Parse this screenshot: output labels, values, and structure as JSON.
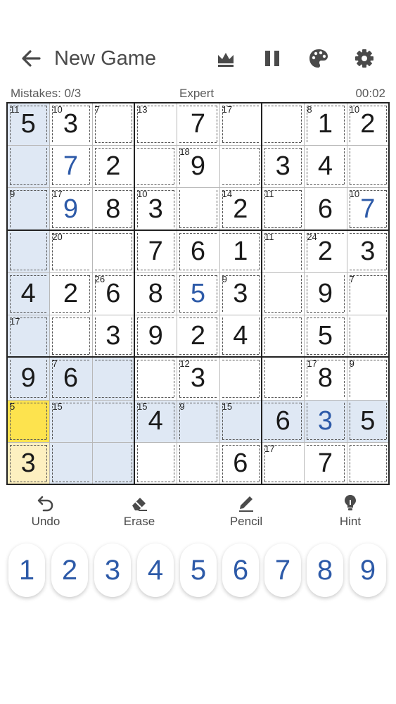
{
  "header": {
    "title": "New Game",
    "icons": [
      "back-arrow-icon",
      "crown-icon",
      "pause-icon",
      "palette-icon",
      "gear-icon"
    ]
  },
  "status": {
    "mistakes": "Mistakes: 0/3",
    "difficulty": "Expert",
    "timer": "00:02"
  },
  "board": {
    "rows": [
      [
        5,
        3,
        0,
        0,
        7,
        0,
        0,
        1,
        2
      ],
      [
        0,
        7,
        2,
        0,
        9,
        0,
        3,
        4,
        0
      ],
      [
        0,
        9,
        8,
        3,
        0,
        2,
        0,
        6,
        7
      ],
      [
        0,
        0,
        0,
        7,
        6,
        1,
        0,
        2,
        3
      ],
      [
        4,
        2,
        6,
        8,
        5,
        3,
        0,
        9,
        0
      ],
      [
        0,
        0,
        3,
        9,
        2,
        4,
        0,
        5,
        0
      ],
      [
        9,
        6,
        0,
        0,
        3,
        0,
        0,
        8,
        0
      ],
      [
        0,
        0,
        0,
        4,
        0,
        0,
        6,
        3,
        5
      ],
      [
        3,
        0,
        0,
        0,
        0,
        6,
        0,
        7,
        0
      ]
    ],
    "user_entered": [
      [
        1,
        1
      ],
      [
        2,
        1
      ],
      [
        2,
        8
      ],
      [
        4,
        4
      ],
      [
        7,
        7
      ]
    ],
    "selected": [
      7,
      0
    ],
    "same_value": [
      [
        8,
        0
      ]
    ],
    "cages": [
      {
        "sum": "11",
        "cells": [
          [
            0,
            0
          ],
          [
            1,
            0
          ]
        ]
      },
      {
        "sum": "10",
        "cells": [
          [
            0,
            1
          ],
          [
            1,
            1
          ]
        ]
      },
      {
        "sum": "7",
        "cells": [
          [
            0,
            2
          ]
        ]
      },
      {
        "sum": "13",
        "cells": [
          [
            0,
            3
          ],
          [
            0,
            4
          ]
        ]
      },
      {
        "sum": "17",
        "cells": [
          [
            0,
            5
          ],
          [
            0,
            6
          ]
        ]
      },
      {
        "sum": "8",
        "cells": [
          [
            0,
            7
          ],
          [
            1,
            7
          ]
        ]
      },
      {
        "sum": "10",
        "cells": [
          [
            0,
            8
          ],
          [
            1,
            8
          ]
        ]
      },
      {
        "sum": "18",
        "cells": [
          [
            1,
            4
          ],
          [
            1,
            5
          ],
          [
            2,
            4
          ]
        ]
      },
      {
        "sum": "",
        "cells": [
          [
            1,
            2
          ],
          [
            1,
            3
          ]
        ]
      },
      {
        "sum": "",
        "cells": [
          [
            1,
            6
          ]
        ]
      },
      {
        "sum": "9",
        "cells": [
          [
            2,
            0
          ],
          [
            3,
            0
          ]
        ]
      },
      {
        "sum": "17",
        "cells": [
          [
            2,
            1
          ],
          [
            2,
            2
          ]
        ]
      },
      {
        "sum": "10",
        "cells": [
          [
            2,
            3
          ],
          [
            3,
            3
          ]
        ]
      },
      {
        "sum": "14",
        "cells": [
          [
            2,
            5
          ],
          [
            2,
            6
          ]
        ]
      },
      {
        "sum": "11",
        "cells": [
          [
            2,
            6
          ]
        ]
      },
      {
        "sum": "10",
        "cells": [
          [
            2,
            8
          ]
        ]
      },
      {
        "sum": "20",
        "cells": [
          [
            3,
            1
          ],
          [
            3,
            2
          ]
        ]
      },
      {
        "sum": "",
        "cells": [
          [
            3,
            4
          ],
          [
            3,
            5
          ]
        ]
      },
      {
        "sum": "11",
        "cells": [
          [
            3,
            6
          ],
          [
            4,
            6
          ]
        ]
      },
      {
        "sum": "24",
        "cells": [
          [
            3,
            7
          ],
          [
            3,
            8
          ],
          [
            4,
            7
          ]
        ]
      },
      {
        "sum": "",
        "cells": [
          [
            4,
            0
          ],
          [
            4,
            1
          ]
        ]
      },
      {
        "sum": "26",
        "cells": [
          [
            4,
            2
          ],
          [
            4,
            3
          ],
          [
            5,
            2
          ]
        ]
      },
      {
        "sum": "",
        "cells": [
          [
            4,
            4
          ]
        ]
      },
      {
        "sum": "9",
        "cells": [
          [
            4,
            5
          ],
          [
            5,
            5
          ]
        ]
      },
      {
        "sum": "7",
        "cells": [
          [
            4,
            8
          ],
          [
            5,
            8
          ]
        ]
      },
      {
        "sum": "17",
        "cells": [
          [
            5,
            0
          ],
          [
            6,
            0
          ]
        ]
      },
      {
        "sum": "",
        "cells": [
          [
            5,
            1
          ]
        ]
      },
      {
        "sum": "",
        "cells": [
          [
            5,
            3
          ],
          [
            5,
            4
          ]
        ]
      },
      {
        "sum": "",
        "cells": [
          [
            5,
            6
          ],
          [
            6,
            6
          ]
        ]
      },
      {
        "sum": "",
        "cells": [
          [
            5,
            7
          ]
        ]
      },
      {
        "sum": "7",
        "cells": [
          [
            6,
            1
          ],
          [
            6,
            2
          ]
        ]
      },
      {
        "sum": "",
        "cells": [
          [
            6,
            3
          ]
        ]
      },
      {
        "sum": "12",
        "cells": [
          [
            6,
            4
          ],
          [
            6,
            5
          ]
        ]
      },
      {
        "sum": "17",
        "cells": [
          [
            6,
            7
          ],
          [
            7,
            7
          ]
        ]
      },
      {
        "sum": "9",
        "cells": [
          [
            6,
            8
          ],
          [
            7,
            8
          ]
        ]
      },
      {
        "sum": "5",
        "cells": [
          [
            7,
            0
          ]
        ]
      },
      {
        "sum": "15",
        "cells": [
          [
            7,
            1
          ],
          [
            7,
            2
          ],
          [
            8,
            1
          ],
          [
            8,
            2
          ]
        ]
      },
      {
        "sum": "15",
        "cells": [
          [
            7,
            3
          ],
          [
            8,
            3
          ]
        ]
      },
      {
        "sum": "9",
        "cells": [
          [
            7,
            4
          ],
          [
            8,
            4
          ]
        ]
      },
      {
        "sum": "15",
        "cells": [
          [
            7,
            5
          ],
          [
            7,
            6
          ]
        ]
      },
      {
        "sum": "",
        "cells": [
          [
            8,
            0
          ]
        ]
      },
      {
        "sum": "",
        "cells": [
          [
            8,
            5
          ]
        ]
      },
      {
        "sum": "17",
        "cells": [
          [
            8,
            6
          ],
          [
            8,
            7
          ]
        ]
      },
      {
        "sum": "",
        "cells": [
          [
            8,
            8
          ]
        ]
      }
    ]
  },
  "tools": [
    {
      "name": "undo",
      "label": "Undo",
      "icon": "undo-icon"
    },
    {
      "name": "erase",
      "label": "Erase",
      "icon": "eraser-icon"
    },
    {
      "name": "pencil",
      "label": "Pencil",
      "icon": "pencil-icon"
    },
    {
      "name": "hint",
      "label": "Hint",
      "icon": "lightbulb-icon"
    }
  ],
  "numpad": [
    "1",
    "2",
    "3",
    "4",
    "5",
    "6",
    "7",
    "8",
    "9"
  ],
  "colors": {
    "text": "#4a4a4a",
    "given_digit": "#1a1a1a",
    "user_digit": "#2d5aa8",
    "highlight": "#dfe8f4",
    "selected": "#fde34e",
    "same_value": "#fdf0c0"
  }
}
